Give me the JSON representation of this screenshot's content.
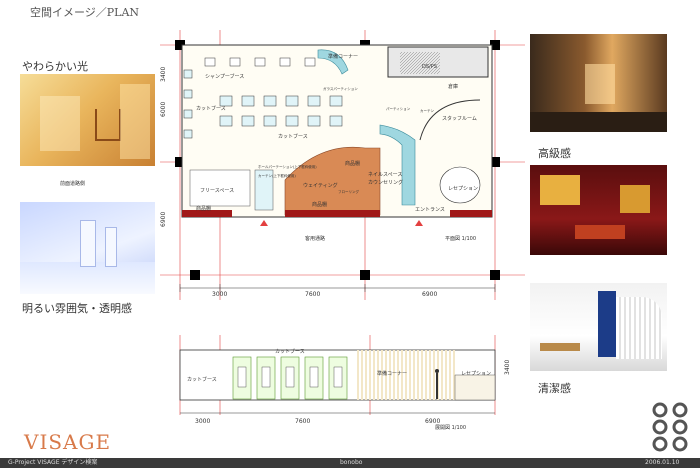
{
  "header": {
    "title": "空間イメージ／PLAN"
  },
  "left_photos": [
    {
      "caption": "やわらかい光"
    },
    {
      "caption": "前面道路側"
    },
    {
      "caption": "明るい雰囲気・透明感"
    }
  ],
  "right_photos": [
    {
      "caption": "高級感"
    },
    {
      "caption": "清潔感"
    }
  ],
  "plan": {
    "rooms": {
      "shampoo": "シャンプーブース",
      "prep": "準備コーナー",
      "ds_ps": "DS/PS",
      "storage": "倉庫",
      "staff": "スタッフルーム",
      "cut1": "カットブース",
      "cut2": "カットブース",
      "free": "フリースペース",
      "goods1": "商品棚",
      "goods2": "商品棚",
      "goods3": "商品棚",
      "waiting": "ウェイティング",
      "nail": "ネイルスペース",
      "counsel": "カウンセリング",
      "reception": "レセプション",
      "entrance": "エントランス",
      "road": "客用通路",
      "scale": "平面図 1/100",
      "glass1": "ガラスパーティション",
      "glass2": "パーティション",
      "curtain": "カーテン",
      "flooring": "フローリング",
      "sub1": "ホールパーテーション(上下框枠使用)",
      "sub2": "カーテン(上下框枠使用)"
    },
    "dims": [
      "3000",
      "7600",
      "6900"
    ],
    "side_dims": [
      "3400",
      "6000",
      "6900"
    ]
  },
  "elevation": {
    "labels": {
      "cut_top": "カットブース",
      "cut_left": "カットブース",
      "prep": "準備コーナー",
      "reception": "レセプション",
      "scale": "展開図 1/100"
    },
    "dims": [
      "3000",
      "7600",
      "6900"
    ],
    "height": "3400"
  },
  "brand": {
    "logo": "VISAGE"
  },
  "footer": {
    "left": "G-Project VISAGE デザイン検案",
    "center": "bonobo",
    "right": "2006.01.10"
  }
}
